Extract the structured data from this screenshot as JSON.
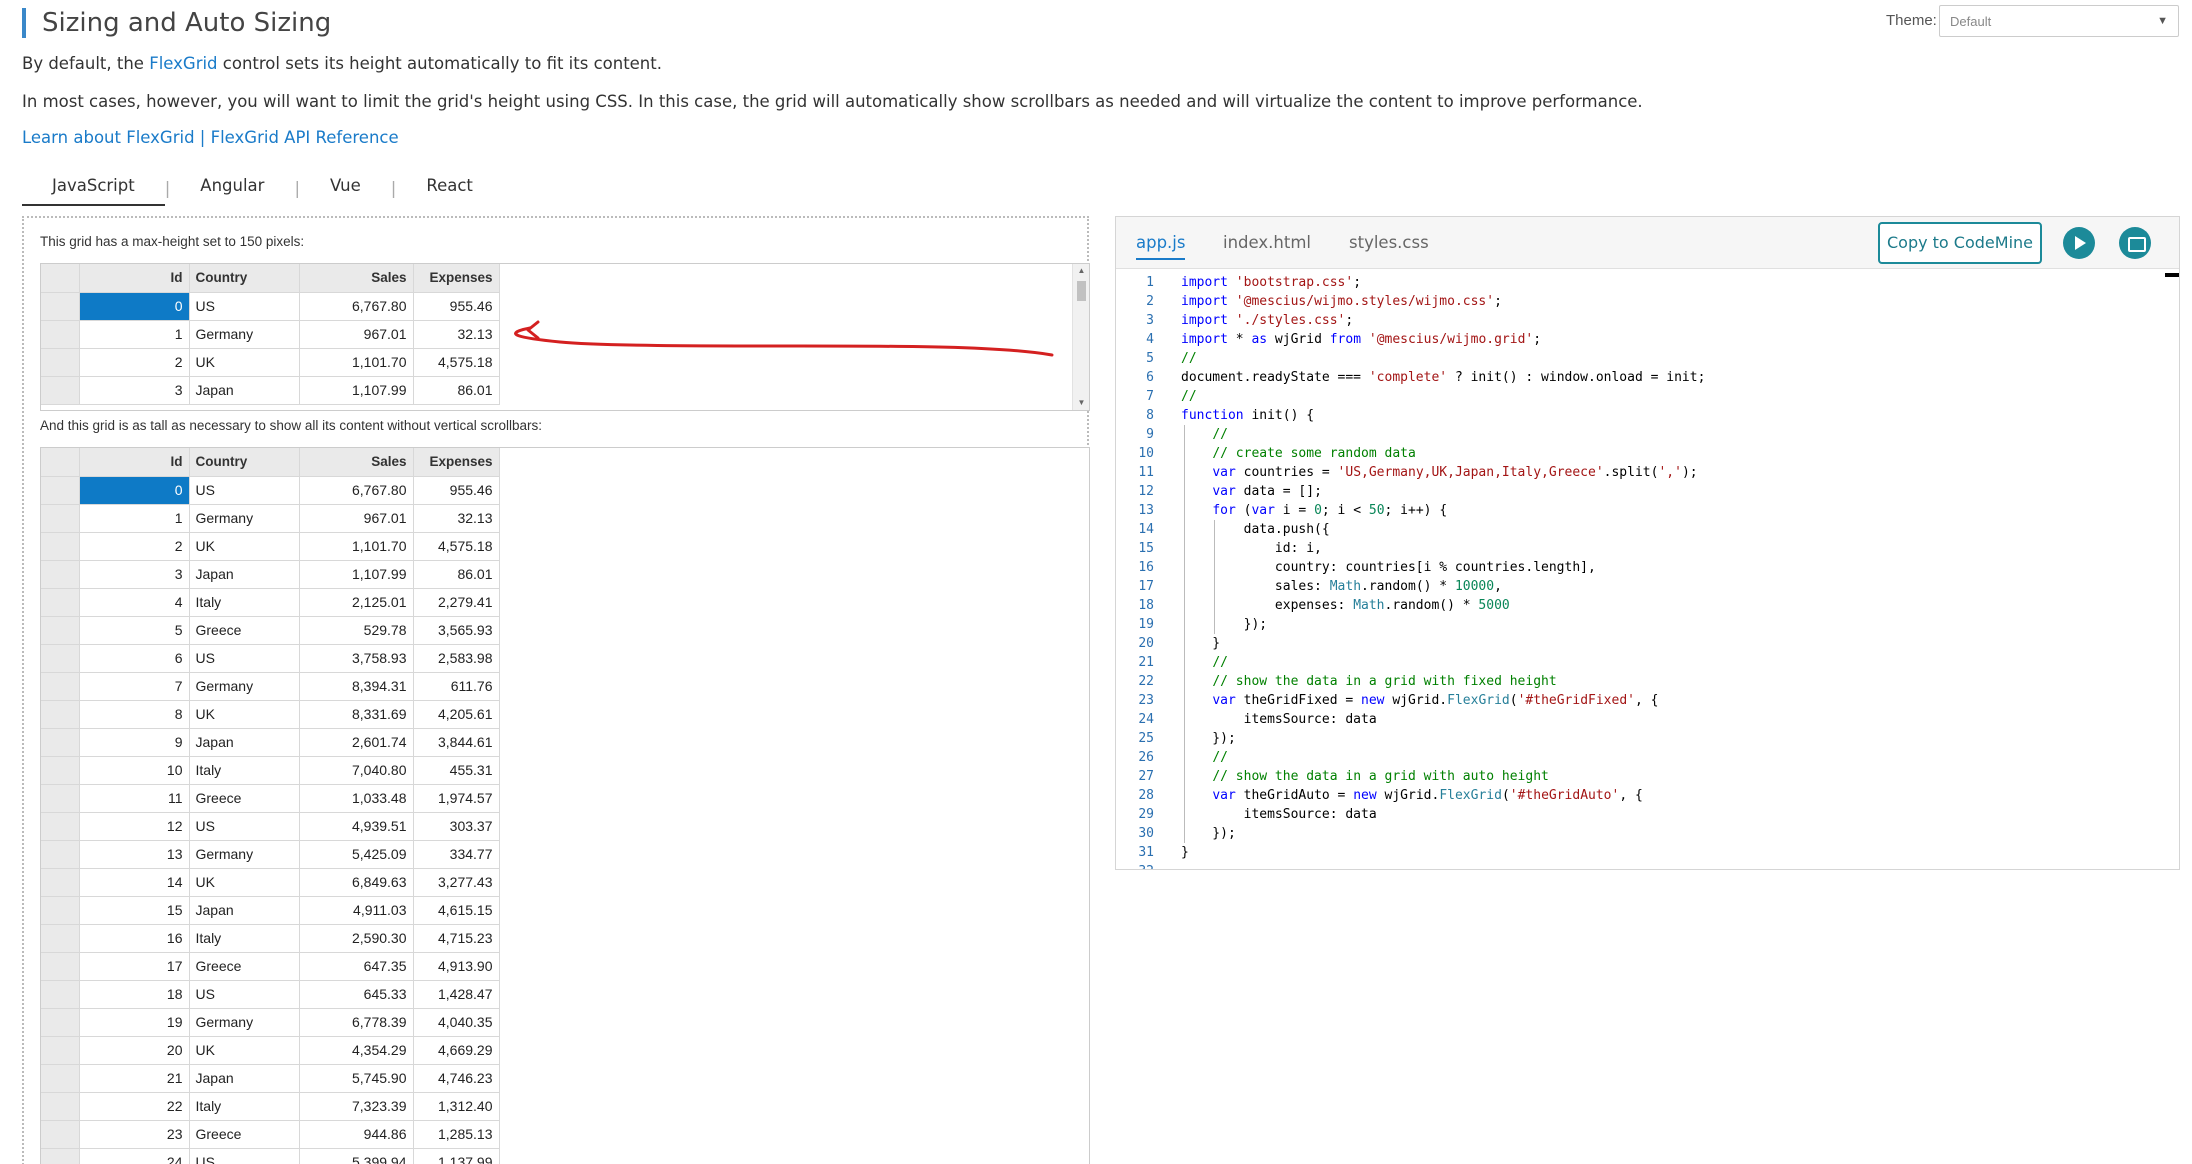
{
  "header": {
    "title": "Sizing and Auto Sizing",
    "theme_label": "Theme:",
    "theme_value": "Default"
  },
  "intro": {
    "p1_before": "By default, the ",
    "p1_link": "FlexGrid",
    "p1_after": " control sets its height automatically to fit its content.",
    "p2": "In most cases, however, you will want to limit the grid's height using CSS. In this case, the grid will automatically show scrollbars as needed and will virtualize the content to improve performance.",
    "link1": "Learn about FlexGrid",
    "link_sep": " | ",
    "link2": "FlexGrid API Reference"
  },
  "framework_tabs": [
    "JavaScript",
    "Angular",
    "Vue",
    "React"
  ],
  "demo": {
    "caption_fixed": "This grid has a max-height set to 150 pixels:",
    "caption_auto": "And this grid is as tall as necessary to show all its content without vertical scrollbars:",
    "columns": [
      "Id",
      "Country",
      "Sales",
      "Expenses"
    ],
    "rows": [
      [
        "0",
        "US",
        "6,767.80",
        "955.46"
      ],
      [
        "1",
        "Germany",
        "967.01",
        "32.13"
      ],
      [
        "2",
        "UK",
        "1,101.70",
        "4,575.18"
      ],
      [
        "3",
        "Japan",
        "1,107.99",
        "86.01"
      ],
      [
        "4",
        "Italy",
        "2,125.01",
        "2,279.41"
      ],
      [
        "5",
        "Greece",
        "529.78",
        "3,565.93"
      ],
      [
        "6",
        "US",
        "3,758.93",
        "2,583.98"
      ],
      [
        "7",
        "Germany",
        "8,394.31",
        "611.76"
      ],
      [
        "8",
        "UK",
        "8,331.69",
        "4,205.61"
      ],
      [
        "9",
        "Japan",
        "2,601.74",
        "3,844.61"
      ],
      [
        "10",
        "Italy",
        "7,040.80",
        "455.31"
      ],
      [
        "11",
        "Greece",
        "1,033.48",
        "1,974.57"
      ],
      [
        "12",
        "US",
        "4,939.51",
        "303.37"
      ],
      [
        "13",
        "Germany",
        "5,425.09",
        "334.77"
      ],
      [
        "14",
        "UK",
        "6,849.63",
        "3,277.43"
      ],
      [
        "15",
        "Japan",
        "4,911.03",
        "4,615.15"
      ],
      [
        "16",
        "Italy",
        "2,590.30",
        "4,715.23"
      ],
      [
        "17",
        "Greece",
        "647.35",
        "4,913.90"
      ],
      [
        "18",
        "US",
        "645.33",
        "1,428.47"
      ],
      [
        "19",
        "Germany",
        "6,778.39",
        "4,040.35"
      ],
      [
        "20",
        "UK",
        "4,354.29",
        "4,669.29"
      ],
      [
        "21",
        "Japan",
        "5,745.90",
        "4,746.23"
      ],
      [
        "22",
        "Italy",
        "7,323.39",
        "1,312.40"
      ],
      [
        "23",
        "Greece",
        "944.86",
        "1,285.13"
      ],
      [
        "24",
        "US",
        "5,399.94",
        "1,137.99"
      ]
    ]
  },
  "code_panel": {
    "tabs": [
      "app.js",
      "index.html",
      "styles.css"
    ],
    "copy_button": "Copy to CodeMine",
    "lines": [
      [
        [
          "kw",
          "import"
        ],
        [
          "",
          " "
        ],
        [
          "str",
          "'bootstrap.css'"
        ],
        [
          "",
          ";"
        ]
      ],
      [
        [
          "kw",
          "import"
        ],
        [
          "",
          " "
        ],
        [
          "str",
          "'@mescius/wijmo.styles/wijmo.css'"
        ],
        [
          "",
          ";"
        ]
      ],
      [
        [
          "kw",
          "import"
        ],
        [
          "",
          " "
        ],
        [
          "str",
          "'./styles.css'"
        ],
        [
          "",
          ";"
        ]
      ],
      [
        [
          "kw",
          "import"
        ],
        [
          "",
          " * "
        ],
        [
          "kw",
          "as"
        ],
        [
          "",
          " wjGrid "
        ],
        [
          "kw",
          "from"
        ],
        [
          "",
          " "
        ],
        [
          "str",
          "'@mescius/wijmo.grid'"
        ],
        [
          "",
          ";"
        ]
      ],
      [
        [
          "cm",
          "//"
        ]
      ],
      [
        [
          "",
          "document.readyState === "
        ],
        [
          "str",
          "'complete'"
        ],
        [
          "",
          " ? init() : window.onload = init;"
        ]
      ],
      [
        [
          "cm",
          "//"
        ]
      ],
      [
        [
          "kw",
          "function"
        ],
        [
          "",
          " init() {"
        ]
      ],
      [
        [
          "",
          "    "
        ],
        [
          "cm",
          "//"
        ]
      ],
      [
        [
          "",
          "    "
        ],
        [
          "cm",
          "// create some random data"
        ]
      ],
      [
        [
          "",
          "    "
        ],
        [
          "kw",
          "var"
        ],
        [
          "",
          " countries = "
        ],
        [
          "str",
          "'US,Germany,UK,Japan,Italy,Greece'"
        ],
        [
          "",
          ".split("
        ],
        [
          "str",
          "','"
        ],
        [
          "",
          ");"
        ]
      ],
      [
        [
          "",
          "    "
        ],
        [
          "kw",
          "var"
        ],
        [
          "",
          " data = [];"
        ]
      ],
      [
        [
          "",
          "    "
        ],
        [
          "kw",
          "for"
        ],
        [
          "",
          " ("
        ],
        [
          "kw",
          "var"
        ],
        [
          "",
          " i = "
        ],
        [
          "num",
          "0"
        ],
        [
          "",
          "; i < "
        ],
        [
          "num",
          "50"
        ],
        [
          "",
          "; i++) {"
        ]
      ],
      [
        [
          "",
          "        data.push({"
        ]
      ],
      [
        [
          "",
          "            id: i,"
        ]
      ],
      [
        [
          "",
          "            country: countries[i % countries.length],"
        ]
      ],
      [
        [
          "",
          "            sales: "
        ],
        [
          "cls",
          "Math"
        ],
        [
          "",
          ".random() * "
        ],
        [
          "num",
          "10000"
        ],
        [
          "",
          ","
        ]
      ],
      [
        [
          "",
          "            expenses: "
        ],
        [
          "cls",
          "Math"
        ],
        [
          "",
          ".random() * "
        ],
        [
          "num",
          "5000"
        ]
      ],
      [
        [
          "",
          "        });"
        ]
      ],
      [
        [
          "",
          "    }"
        ]
      ],
      [
        [
          "",
          "    "
        ],
        [
          "cm",
          "//"
        ]
      ],
      [
        [
          "",
          "    "
        ],
        [
          "cm",
          "// show the data in a grid with fixed height"
        ]
      ],
      [
        [
          "",
          "    "
        ],
        [
          "kw",
          "var"
        ],
        [
          "",
          " theGridFixed = "
        ],
        [
          "kw",
          "new"
        ],
        [
          "",
          " wjGrid."
        ],
        [
          "cls",
          "FlexGrid"
        ],
        [
          "",
          "("
        ],
        [
          "str",
          "'#theGridFixed'"
        ],
        [
          "",
          ", {"
        ]
      ],
      [
        [
          "",
          "        itemsSource: data"
        ]
      ],
      [
        [
          "",
          "    });"
        ]
      ],
      [
        [
          "",
          "    "
        ],
        [
          "cm",
          "//"
        ]
      ],
      [
        [
          "",
          "    "
        ],
        [
          "cm",
          "// show the data in a grid with auto height"
        ]
      ],
      [
        [
          "",
          "    "
        ],
        [
          "kw",
          "var"
        ],
        [
          "",
          " theGridAuto = "
        ],
        [
          "kw",
          "new"
        ],
        [
          "",
          " wjGrid."
        ],
        [
          "cls",
          "FlexGrid"
        ],
        [
          "",
          "("
        ],
        [
          "str",
          "'#theGridAuto'"
        ],
        [
          "",
          ", {"
        ]
      ],
      [
        [
          "",
          "        itemsSource: data"
        ]
      ],
      [
        [
          "",
          "    });"
        ]
      ],
      [
        [
          "",
          "}"
        ]
      ],
      [
        [
          "",
          ""
        ]
      ]
    ]
  }
}
